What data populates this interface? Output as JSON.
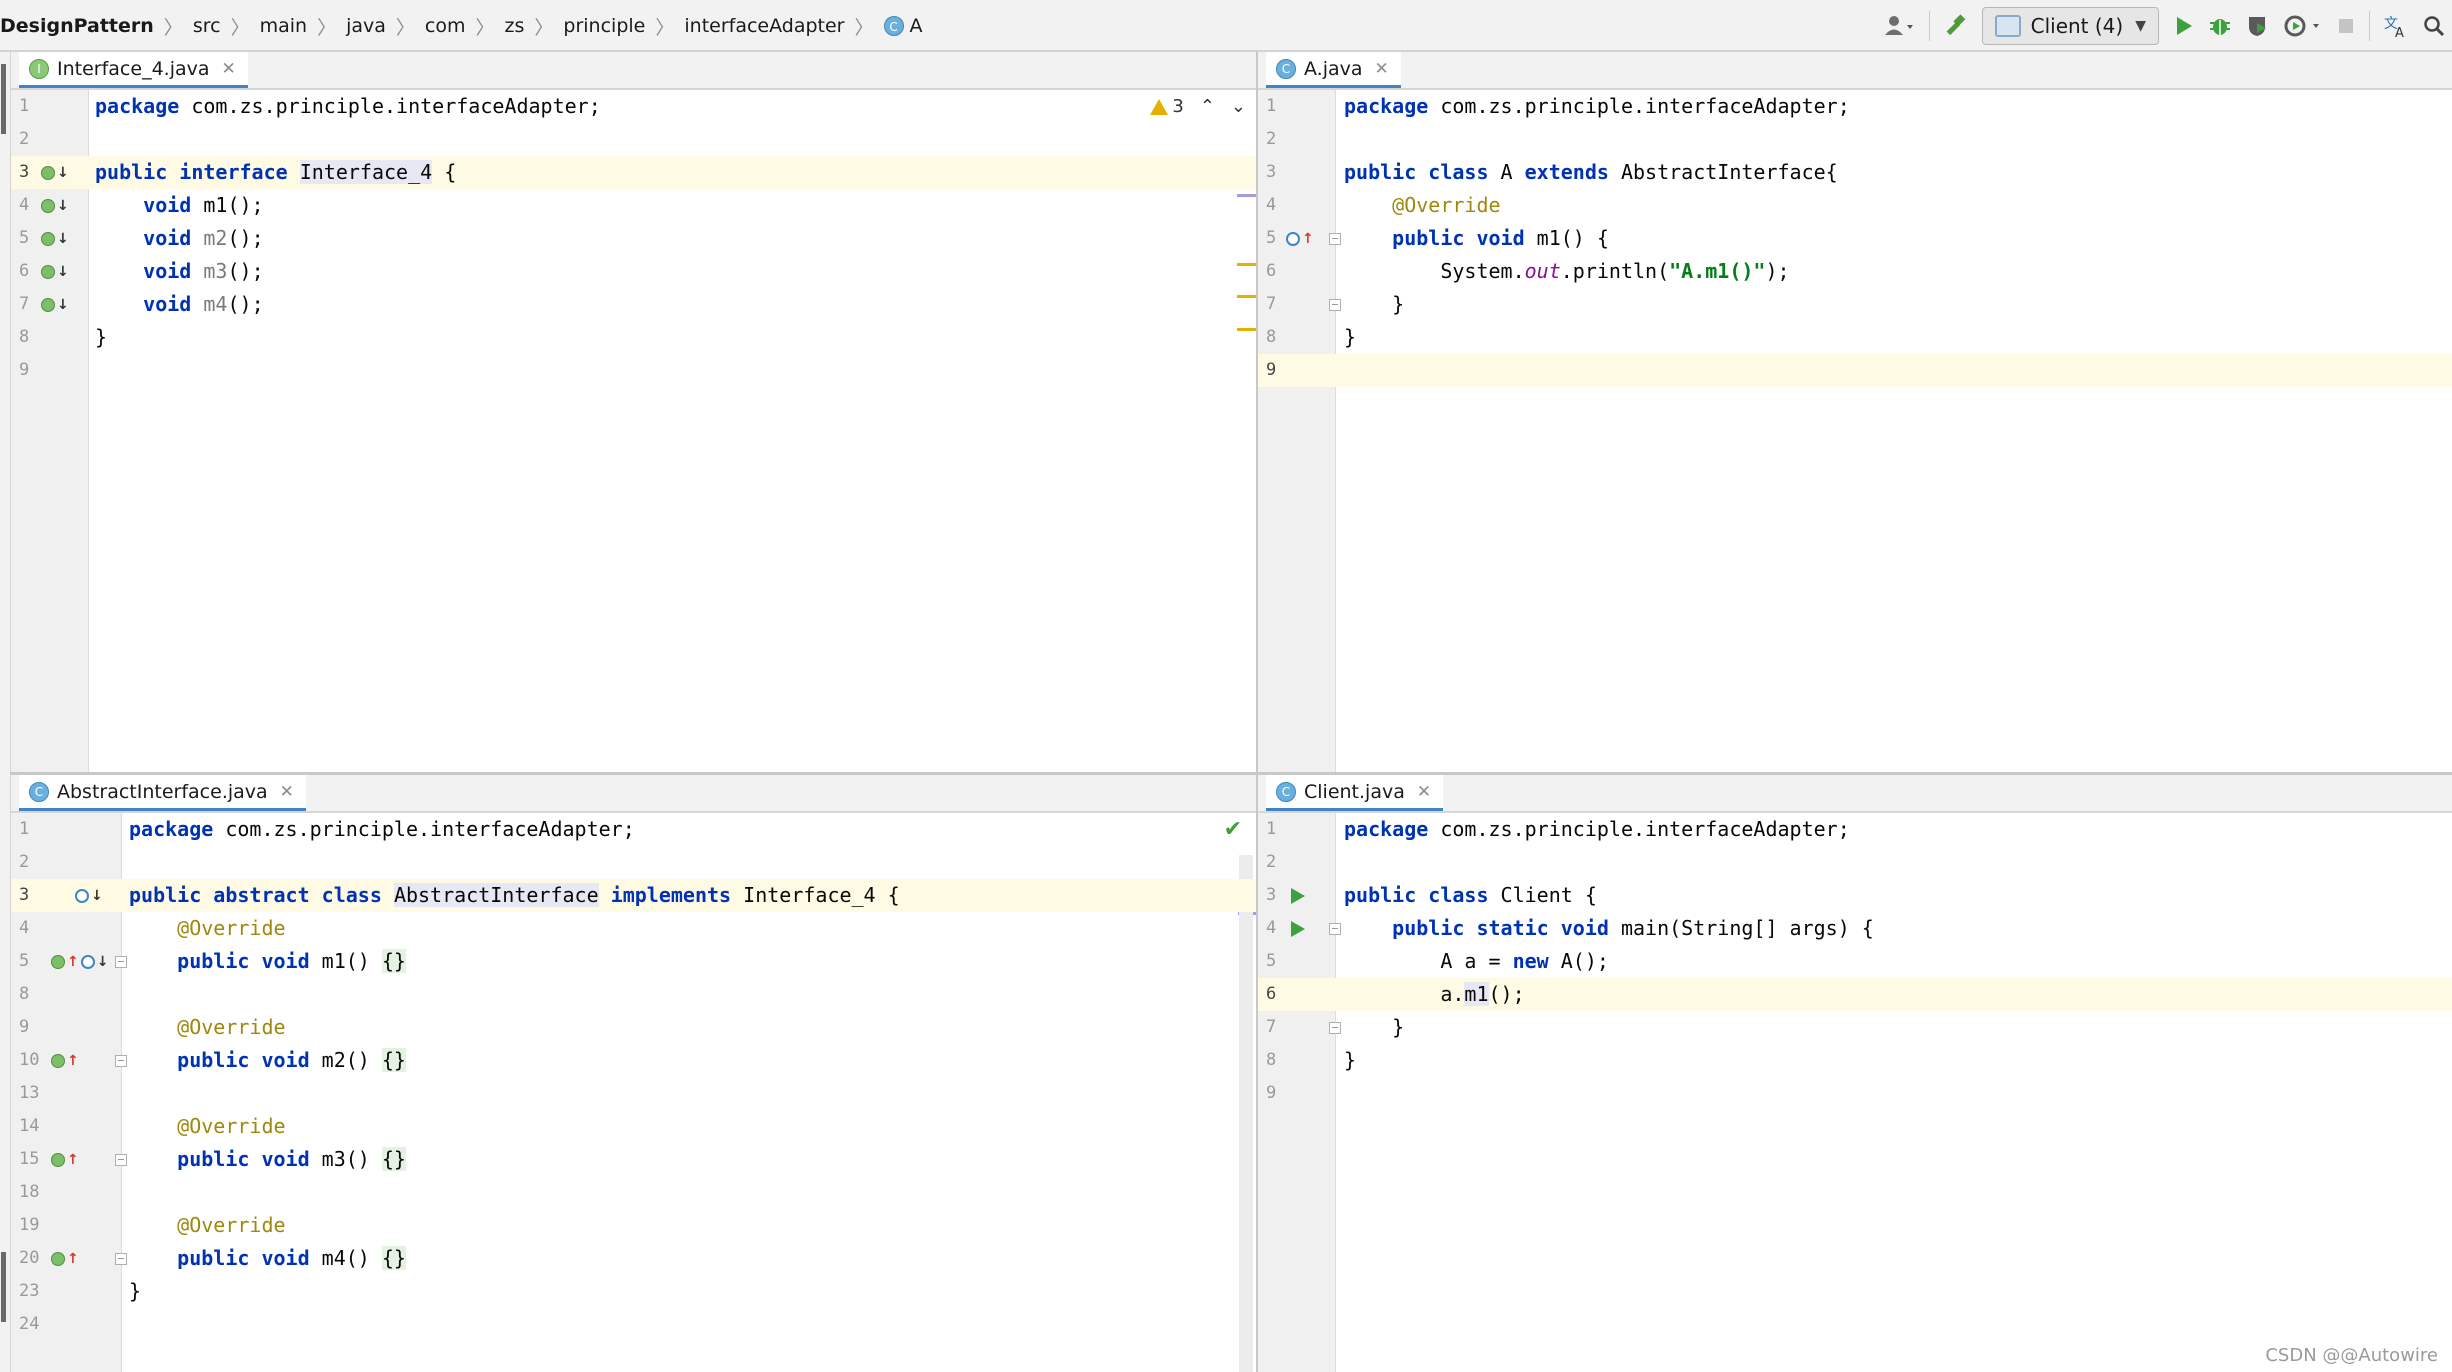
{
  "navbar": {
    "project": "DesignPattern",
    "crumbs": [
      "src",
      "main",
      "java",
      "com",
      "zs",
      "principle",
      "interfaceAdapter"
    ],
    "current_class": "A",
    "class_icon_letter": "C",
    "run_config": "Client (4)"
  },
  "panes": {
    "top_left": {
      "tab": "Interface_4.java",
      "tab_icon": "I",
      "warnings": "3"
    },
    "top_right": {
      "tab": "A.java",
      "tab_icon": "C"
    },
    "bottom_left": {
      "tab": "AbstractInterface.java",
      "tab_icon": "C"
    },
    "bottom_right": {
      "tab": "Client.java",
      "tab_icon": "C"
    }
  },
  "code": {
    "iface": [
      {
        "n": "1",
        "t": "package com.zs.principle.interfaceAdapter;"
      },
      {
        "n": "2",
        "t": ""
      },
      {
        "n": "3",
        "t": "public interface Interface_4 {"
      },
      {
        "n": "4",
        "t": "    void m1();"
      },
      {
        "n": "5",
        "t": "    void m2();"
      },
      {
        "n": "6",
        "t": "    void m3();"
      },
      {
        "n": "7",
        "t": "    void m4();"
      },
      {
        "n": "8",
        "t": "}"
      },
      {
        "n": "9",
        "t": ""
      }
    ],
    "a": [
      {
        "n": "1",
        "t": "package com.zs.principle.interfaceAdapter;"
      },
      {
        "n": "2",
        "t": ""
      },
      {
        "n": "3",
        "t": "public class A extends AbstractInterface{"
      },
      {
        "n": "4",
        "t": "    @Override"
      },
      {
        "n": "5",
        "t": "    public void m1() {"
      },
      {
        "n": "6",
        "t": "        System.out.println(\"A.m1()\");"
      },
      {
        "n": "7",
        "t": "    }"
      },
      {
        "n": "8",
        "t": "}"
      },
      {
        "n": "9",
        "t": ""
      }
    ],
    "abstract": [
      {
        "n": "1",
        "t": "package com.zs.principle.interfaceAdapter;"
      },
      {
        "n": "2",
        "t": ""
      },
      {
        "n": "3",
        "t": "public abstract class AbstractInterface implements Interface_4 {"
      },
      {
        "n": "4",
        "t": "    @Override"
      },
      {
        "n": "5",
        "t": "    public void m1() {}"
      },
      {
        "n": "8",
        "t": ""
      },
      {
        "n": "9",
        "t": "    @Override"
      },
      {
        "n": "10",
        "t": "    public void m2() {}"
      },
      {
        "n": "13",
        "t": ""
      },
      {
        "n": "14",
        "t": "    @Override"
      },
      {
        "n": "15",
        "t": "    public void m3() {}"
      },
      {
        "n": "18",
        "t": ""
      },
      {
        "n": "19",
        "t": "    @Override"
      },
      {
        "n": "20",
        "t": "    public void m4() {}"
      },
      {
        "n": "23",
        "t": "}"
      },
      {
        "n": "24",
        "t": ""
      }
    ],
    "client": [
      {
        "n": "1",
        "t": "package com.zs.principle.interfaceAdapter;"
      },
      {
        "n": "2",
        "t": ""
      },
      {
        "n": "3",
        "t": "public class Client {"
      },
      {
        "n": "4",
        "t": "    public static void main(String[] args) {"
      },
      {
        "n": "5",
        "t": "        A a = new A();"
      },
      {
        "n": "6",
        "t": "        a.m1();"
      },
      {
        "n": "7",
        "t": "    }"
      },
      {
        "n": "8",
        "t": "}"
      },
      {
        "n": "9",
        "t": ""
      }
    ]
  },
  "watermark": "CSDN @@Autowire",
  "colors": {
    "keyword": "#0033b3",
    "annotation": "#9e880d",
    "string": "#067d17",
    "static_field": "#871094",
    "current_line": "#fffae3",
    "tab_underline": "#4083c9"
  }
}
